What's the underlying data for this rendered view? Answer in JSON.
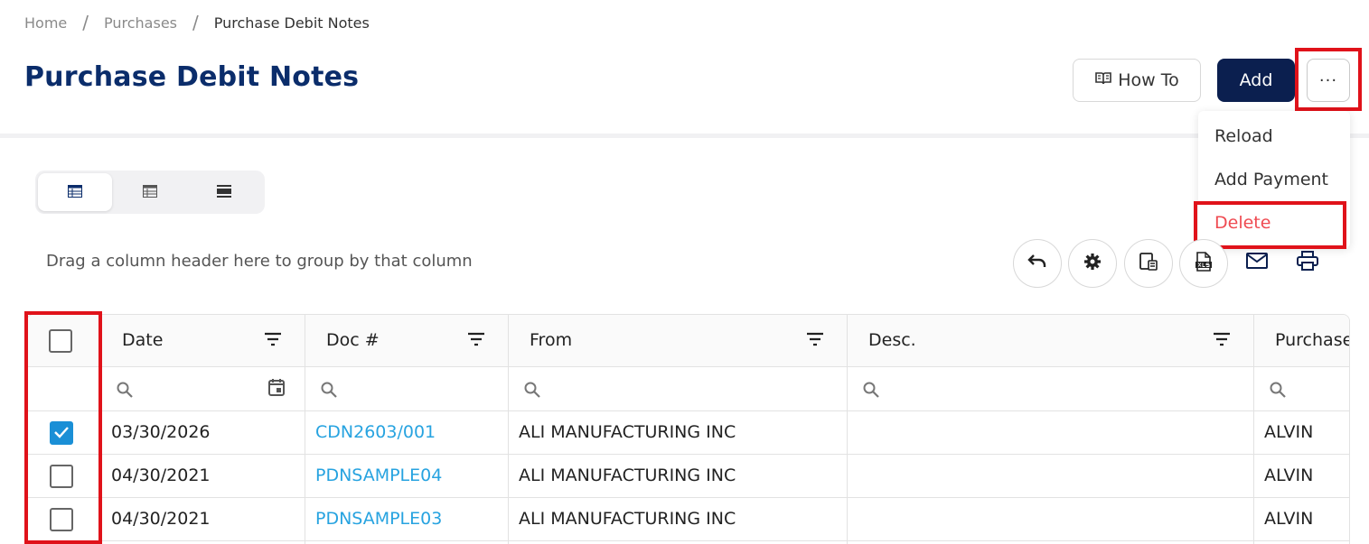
{
  "breadcrumb": {
    "items": [
      "Home",
      "Purchases",
      "Purchase Debit Notes"
    ]
  },
  "page": {
    "title": "Purchase Debit Notes"
  },
  "header_actions": {
    "howto_label": "How To",
    "add_label": "Add",
    "more_label": "···"
  },
  "menu": {
    "items": [
      "Reload",
      "Add Payment",
      "Delete"
    ]
  },
  "group_hint": "Drag a column header here to group by that column",
  "table": {
    "columns": [
      "Date",
      "Doc #",
      "From",
      "Desc.",
      "Purchase"
    ],
    "rows": [
      {
        "checked": true,
        "date": "03/30/2026",
        "doc": "CDN2603/001",
        "from": "ALI MANUFACTURING INC",
        "desc": "",
        "purchaser": "ALVIN"
      },
      {
        "checked": false,
        "date": "04/30/2021",
        "doc": "PDNSAMPLE04",
        "from": "ALI MANUFACTURING INC",
        "desc": "",
        "purchaser": "ALVIN"
      },
      {
        "checked": false,
        "date": "04/30/2021",
        "doc": "PDNSAMPLE03",
        "from": "ALI MANUFACTURING INC",
        "desc": "",
        "purchaser": "ALVIN"
      }
    ]
  },
  "colors": {
    "brand": "#0b2d6b",
    "primary_button": "#0b1f4f",
    "link": "#27a3e0",
    "danger": "#ef4b52",
    "highlight": "#e0121a",
    "checkbox": "#1a8fd6"
  },
  "icons": [
    "book-icon",
    "table-view-icon",
    "list-view-icon",
    "compact-view-icon",
    "undo-icon",
    "gear-icon",
    "export-icon",
    "xls-icon",
    "mail-icon",
    "print-icon",
    "filter-icon",
    "search-icon",
    "calendar-icon",
    "check-icon"
  ]
}
